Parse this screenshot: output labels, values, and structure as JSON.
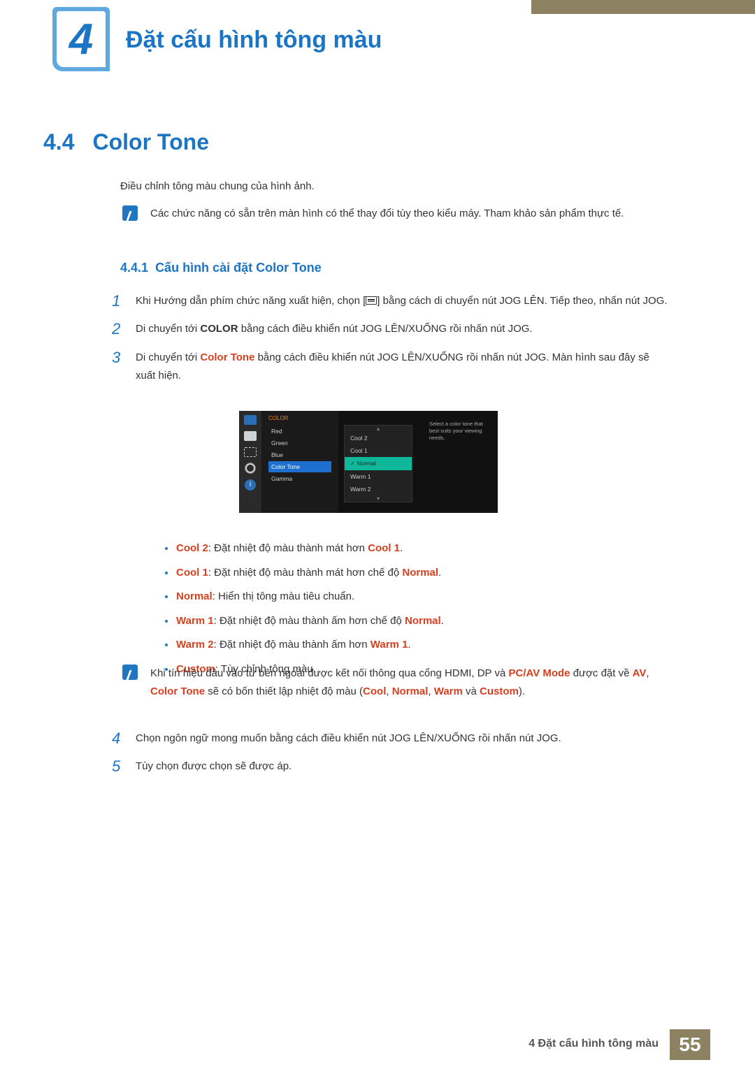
{
  "chapter": {
    "number": "4",
    "title": "Đặt cấu hình tông màu"
  },
  "section": {
    "number": "4.4",
    "title": "Color Tone"
  },
  "intro": "Điều chỉnh tông màu chung của hình ảnh.",
  "note1": "Các chức năng có sẵn trên màn hình có thể thay đổi tùy theo kiểu máy. Tham khảo sản phẩm thực tế.",
  "subsection": {
    "number": "4.4.1",
    "title": "Cấu hình cài đặt Color Tone"
  },
  "steps": {
    "s1": {
      "num": "1",
      "before": "Khi Hướng dẫn phím chức năng xuất hiện, chọn [",
      "after": "] bằng cách di chuyển nút JOG LÊN. Tiếp theo, nhấn nút JOG."
    },
    "s2": {
      "num": "2",
      "pre": "Di chuyển tới ",
      "kw": "COLOR",
      "post": " bằng cách điều khiển nút JOG LÊN/XUỐNG rồi nhấn nút JOG."
    },
    "s3": {
      "num": "3",
      "pre": "Di chuyển tới ",
      "kw": "Color Tone",
      "post": " bằng cách điều khiển nút JOG LÊN/XUỐNG rồi nhấn nút JOG. Màn hình sau đây sẽ xuất hiện."
    },
    "s4": {
      "num": "4",
      "text": "Chọn ngôn ngữ mong muốn bằng cách điều khiển nút JOG LÊN/XUỐNG rồi nhấn nút JOG."
    },
    "s5": {
      "num": "5",
      "text": "Tùy chọn được chọn sẽ được áp."
    }
  },
  "osd": {
    "header": "COLOR",
    "menu": [
      "Red",
      "Green",
      "Blue",
      "Color Tone",
      "Gamma"
    ],
    "menu_selected": "Color Tone",
    "options": [
      "Cool 2",
      "Cool 1",
      "Normal",
      "Warm 1",
      "Warm 2"
    ],
    "option_selected": "Normal",
    "help": "Select a color tone that best suits your viewing needs."
  },
  "bullets": {
    "b1": {
      "kw": "Cool 2",
      "mid": ": Đặt nhiệt độ màu thành mát hơn ",
      "kw2": "Cool 1",
      "tail": "."
    },
    "b2": {
      "kw": "Cool 1",
      "mid": ": Đặt nhiệt độ màu thành mát hơn chế độ ",
      "kw2": "Normal",
      "tail": "."
    },
    "b3": {
      "kw": "Normal",
      "mid": ": Hiển thị tông màu tiêu chuẩn."
    },
    "b4": {
      "kw": "Warm 1",
      "mid": ": Đặt nhiệt độ màu thành ấm hơn chế độ ",
      "kw2": "Normal",
      "tail": "."
    },
    "b5": {
      "kw": "Warm 2",
      "mid": ": Đặt nhiệt độ màu thành ấm hơn ",
      "kw2": "Warm 1",
      "tail": "."
    },
    "b6": {
      "kw": "Custom",
      "mid": ": Tùy chỉnh tông màu."
    }
  },
  "note2": {
    "t1": "Khi tín hiệu đầu vào từ bên ngoài được kết nối thông qua cổng HDMI, DP và ",
    "k1": "PC/AV Mode",
    "t2": " được đặt về ",
    "k2": "AV",
    "t3": ", ",
    "k3": "Color Tone",
    "t4": " sẽ có bốn thiết lập nhiệt độ màu (",
    "k4": "Cool",
    "t5": ", ",
    "k5": "Normal",
    "t6": ", ",
    "k6": "Warm",
    "t7": " và ",
    "k7": "Custom",
    "t8": ")."
  },
  "footer": {
    "chapter_label": "4 Đặt cấu hình tông màu",
    "page": "55"
  }
}
